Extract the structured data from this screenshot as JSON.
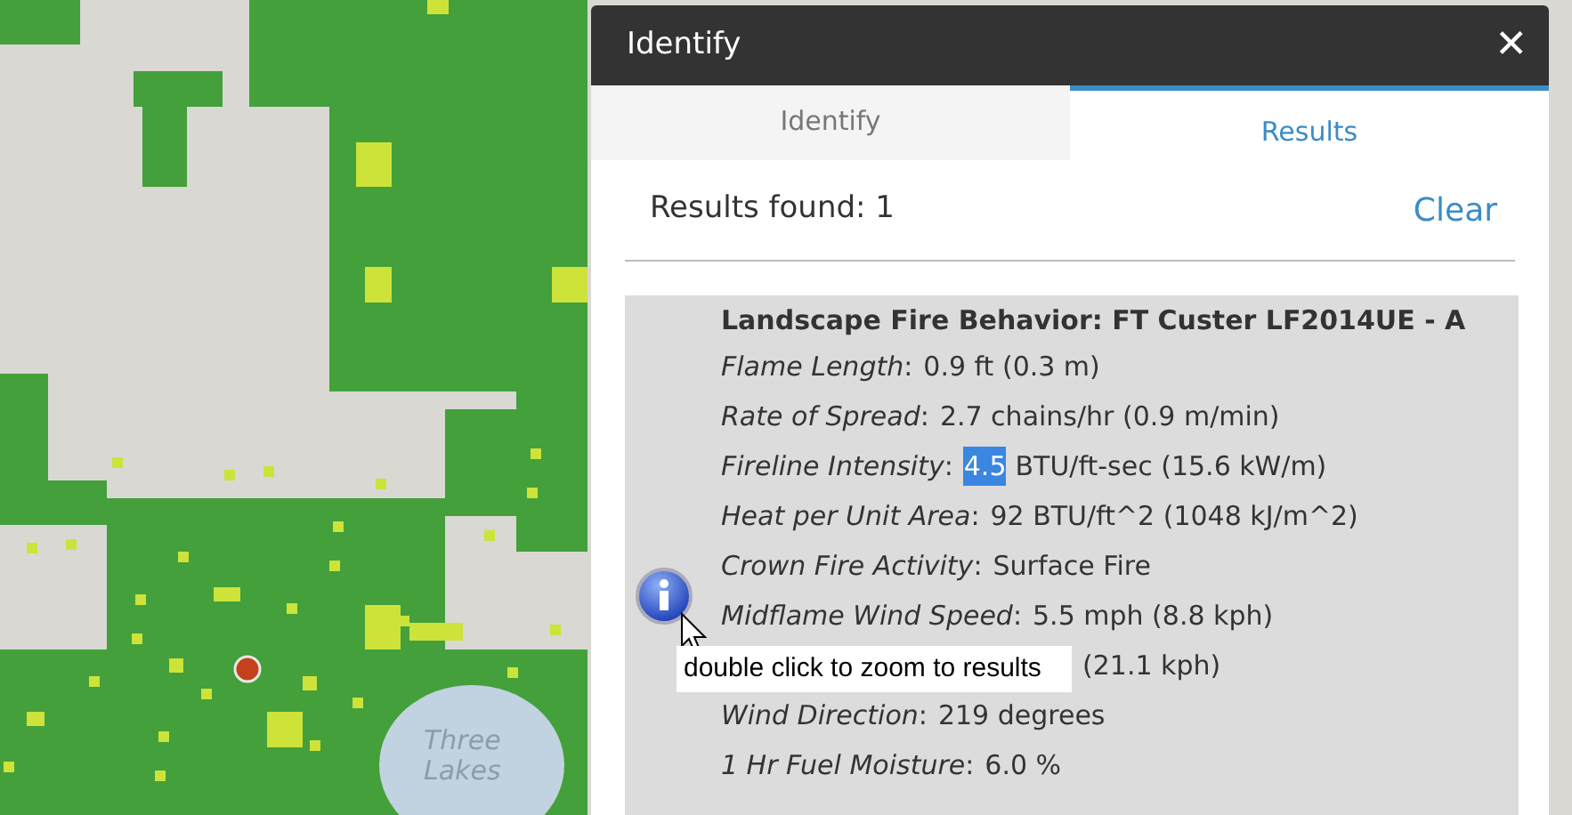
{
  "map": {
    "labels": [
      "Three",
      "Lakes"
    ]
  },
  "panel": {
    "title": "Identify",
    "close": "✕",
    "tabs": [
      {
        "label": "Identify",
        "selected": false
      },
      {
        "label": "Results",
        "selected": true
      }
    ],
    "results_found": "Results found: 1",
    "clear": "Clear",
    "result": {
      "title": "Landscape Fire Behavior: FT Custer LF2014UE - A",
      "attributes": [
        {
          "label": "Flame Length",
          "separator": ":",
          "value": [
            {
              "text": "0.9 ft (0.3 m)",
              "selected": false
            }
          ]
        },
        {
          "label": "Rate of Spread",
          "separator": ":",
          "value": [
            {
              "text": "2.7 chains/hr (0.9 m/min)",
              "selected": false
            }
          ]
        },
        {
          "label": "Fireline Intensity",
          "separator": ":",
          "value": [
            {
              "text": "4.5",
              "selected": true
            },
            {
              "text": "BTU/ft-sec (15.6 kW/m)",
              "selected": false
            }
          ]
        },
        {
          "label": "Heat per Unit Area",
          "separator": ":",
          "value": [
            {
              "text": "92 BTU/ft^2 (1048 kJ/m^2)",
              "selected": false
            }
          ]
        },
        {
          "label": "Crown Fire Activity",
          "separator": ":",
          "value": [
            {
              "text": "Surface Fire",
              "selected": false
            }
          ]
        },
        {
          "label": "Midflame Wind Speed",
          "separator": ":",
          "value": [
            {
              "text": "5.5 mph (8.8 kph)",
              "selected": false
            }
          ]
        },
        {
          "value": [
            {
              "text": "(21.1 kph)",
              "selected": false
            }
          ]
        },
        {
          "label": "Wind Direction",
          "separator": ":",
          "value": [
            {
              "text": "219 degrees",
              "selected": false
            }
          ]
        },
        {
          "label": "1 Hr Fuel Moisture",
          "separator": ":",
          "value": [
            {
              "text": "6.0 %",
              "selected": false
            }
          ]
        }
      ]
    },
    "tooltip": "double click to zoom to results"
  }
}
